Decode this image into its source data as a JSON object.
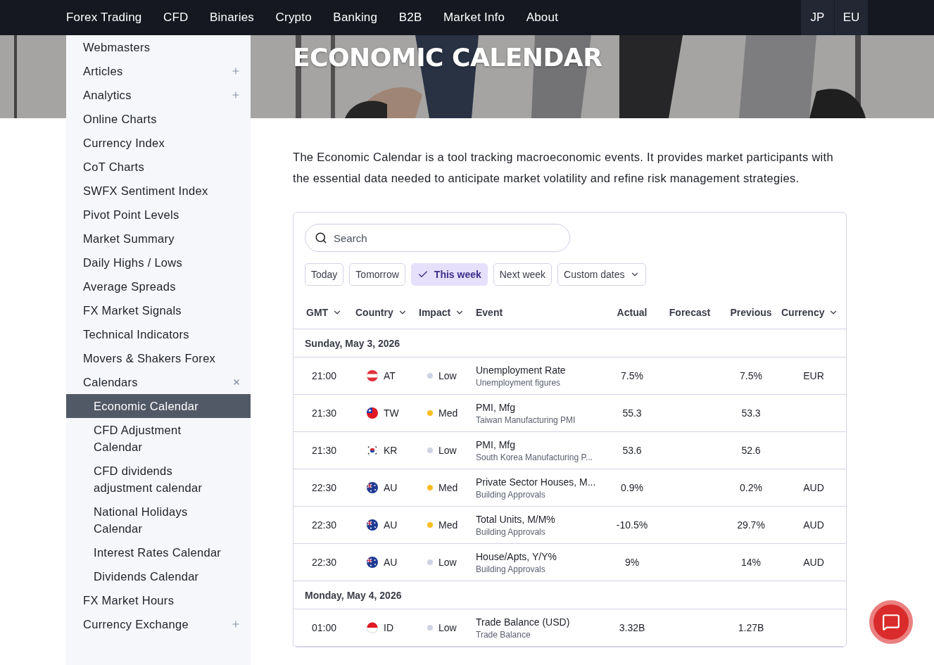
{
  "nav": {
    "items": [
      {
        "label": "Forex Trading"
      },
      {
        "label": "CFD"
      },
      {
        "label": "Binaries"
      },
      {
        "label": "Crypto"
      },
      {
        "label": "Banking"
      },
      {
        "label": "B2B"
      },
      {
        "label": "Market Info"
      },
      {
        "label": "About"
      }
    ],
    "regions": [
      {
        "label": "JP"
      },
      {
        "label": "EU"
      }
    ]
  },
  "sidebar": {
    "items": [
      {
        "label": "Webmasters",
        "selected": false
      },
      {
        "label": "Articles",
        "selected": false,
        "expanded": false
      },
      {
        "label": "Analytics",
        "selected": false,
        "expanded": false
      },
      {
        "label": "Online Charts",
        "selected": false
      },
      {
        "label": "Currency Index",
        "selected": false
      },
      {
        "label": "CoT Charts",
        "selected": false
      },
      {
        "label": "SWFX Sentiment Index",
        "selected": false
      },
      {
        "label": "Pivot Point Levels",
        "selected": false
      },
      {
        "label": "Market Summary",
        "selected": false
      },
      {
        "label": "Daily Highs / Lows",
        "selected": false
      },
      {
        "label": "Average Spreads",
        "selected": false
      },
      {
        "label": "FX Market Signals",
        "selected": false
      },
      {
        "label": "Technical Indicators",
        "selected": false
      },
      {
        "label": "Movers & Shakers Forex",
        "selected": false
      },
      {
        "label": "Calendars",
        "selected": false,
        "expanded": true,
        "children": [
          {
            "label": "Economic Calendar",
            "selected": true
          },
          {
            "label": "CFD Adjustment Calendar",
            "selected": false
          },
          {
            "label": "CFD dividends adjustment calendar",
            "selected": false
          },
          {
            "label": "National Holidays Calendar",
            "selected": false
          },
          {
            "label": "Interest Rates Calendar",
            "selected": false
          },
          {
            "label": "Dividends Calendar",
            "selected": false
          }
        ]
      },
      {
        "label": "FX Market Hours",
        "selected": false
      },
      {
        "label": "Currency Exchange",
        "selected": false,
        "expanded": false
      }
    ]
  },
  "hero": {
    "kind": "picture",
    "title": "ECONOMIC CALENDAR"
  },
  "intro": "The Economic Calendar is a tool tracking macroeconomic events. It provides market participants with the essential data needed to anticipate market volatility and refine risk management strategies.",
  "calendar": {
    "search": {
      "placeholder": "Search"
    },
    "filters": [
      {
        "label": "Today",
        "selected": false,
        "kind": "chip"
      },
      {
        "label": "Tomorrow",
        "selected": false,
        "kind": "chip"
      },
      {
        "label": "This week",
        "selected": true,
        "kind": "chip"
      },
      {
        "label": "Next week",
        "selected": false,
        "kind": "chip"
      },
      {
        "label": "Custom dates",
        "selected": false,
        "kind": "dropdown"
      }
    ],
    "columns": [
      {
        "label": "GMT",
        "sortable": true
      },
      {
        "label": "Country",
        "sortable": true
      },
      {
        "label": "Impact",
        "sortable": true
      },
      {
        "label": "Event",
        "sortable": false
      },
      {
        "label": "Actual",
        "sortable": false
      },
      {
        "label": "Forecast",
        "sortable": false
      },
      {
        "label": "Previous",
        "sortable": false
      },
      {
        "label": "Currency",
        "sortable": true
      }
    ],
    "days": [
      {
        "date": "Sunday, May 3, 2026",
        "rows": [
          {
            "time": "21:00",
            "country": {
              "code": "AT",
              "kind": "austria"
            },
            "impact": {
              "label": "Low",
              "color": "#cfd3e3"
            },
            "event": "Unemployment Rate",
            "description": "Unemployment figures",
            "actual": "7.5%",
            "previous": "7.5%",
            "currency": "EUR"
          },
          {
            "time": "21:30",
            "country": {
              "code": "TW",
              "kind": "taiwan"
            },
            "impact": {
              "label": "Med",
              "color": "#fbbd23"
            },
            "event": "PMI, Mfg",
            "description": "Taiwan Manufacturing PMI",
            "actual": "55.3",
            "previous": "53.3"
          },
          {
            "time": "21:30",
            "country": {
              "code": "KR",
              "kind": "korea"
            },
            "impact": {
              "label": "Low",
              "color": "#cfd3e3"
            },
            "event": "PMI, Mfg",
            "description": "South Korea Manufacturing P...",
            "actual": "53.6",
            "previous": "52.6"
          },
          {
            "time": "22:30",
            "country": {
              "code": "AU",
              "kind": "australia"
            },
            "impact": {
              "label": "Med",
              "color": "#fbbd23"
            },
            "event": "Private Sector Houses, M...",
            "description": "Building Approvals",
            "actual": "0.9%",
            "previous": "0.2%",
            "currency": "AUD"
          },
          {
            "time": "22:30",
            "country": {
              "code": "AU",
              "kind": "australia"
            },
            "impact": {
              "label": "Med",
              "color": "#fbbd23"
            },
            "event": "Total Units, M/M%",
            "description": "Building Approvals",
            "actual": "-10.5%",
            "previous": "29.7%",
            "currency": "AUD"
          },
          {
            "time": "22:30",
            "country": {
              "code": "AU",
              "kind": "australia"
            },
            "impact": {
              "label": "Low",
              "color": "#cfd3e3"
            },
            "event": "House/Apts, Y/Y%",
            "description": "Building Approvals",
            "actual": "9%",
            "previous": "14%",
            "currency": "AUD"
          }
        ]
      },
      {
        "date": "Monday, May 4, 2026",
        "rows": [
          {
            "time": "01:00",
            "country": {
              "code": "ID",
              "kind": "indonesia"
            },
            "impact": {
              "label": "Low",
              "color": "#cfd3e3"
            },
            "event": "Trade Balance (USD)",
            "description": "Trade Balance",
            "actual": "3.32B",
            "previous": "1.27B"
          }
        ]
      }
    ]
  }
}
